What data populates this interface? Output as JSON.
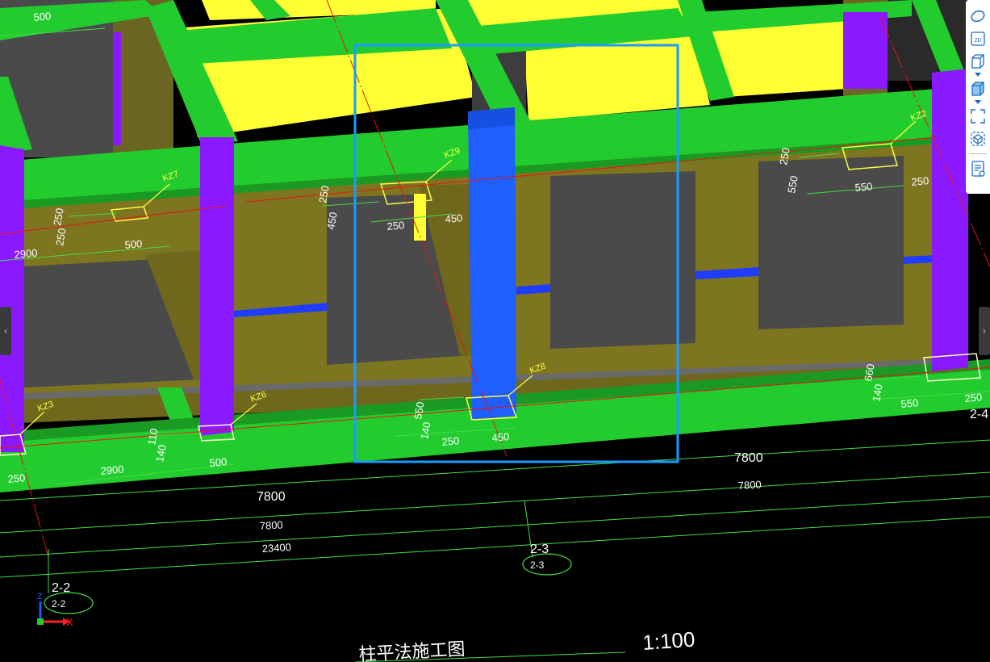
{
  "drawing": {
    "column_labels": {
      "kz2": "KZ2",
      "kz3": "KZ3",
      "kz6": "KZ6",
      "kz7": "KZ7",
      "kz8": "KZ8",
      "kz9": "KZ9"
    },
    "dims": {
      "d500_top": "500",
      "d2900_left": "2900",
      "d500_kz7": "500",
      "d250_kz7a": "250",
      "d250_kz7b": "250",
      "d250_kz9": "250",
      "d450_kz9": "450",
      "d250_kz9v": "250",
      "d450_kz9v": "450",
      "d250_kz2v": "250",
      "d550_kz2v": "550",
      "d550_kz2": "550",
      "d250_kz2": "250",
      "d140_kz6": "140",
      "d110_kz6": "110",
      "d500_kz6": "500",
      "d2900_bottom": "2900",
      "d250_left_bottom": "250",
      "d140_kz8": "140",
      "d550_kz8": "550",
      "d250_kz8": "250",
      "d450_kz8": "450",
      "d660_right": "660",
      "d140_right": "140",
      "d550_right": "550",
      "d250_right": "250",
      "d7800_a": "7800",
      "d7800_b": "7800",
      "d7800_c": "7800",
      "d7800_d": "7800",
      "d23400": "23400"
    },
    "axes": {
      "axis_2_2_label": "2-2",
      "axis_2_2_bubble": "2-2",
      "axis_2_3_label": "2-3",
      "axis_2_3_bubble": "2-3",
      "axis_2_4_label": "2-4"
    },
    "ucs": {
      "z": "Z",
      "x": "X"
    },
    "title": "柱平法施工图",
    "scale": "1:100"
  },
  "toolbar": {
    "icons": [
      "orbit-icon",
      "2d-icon",
      "3d-box-icon",
      "shaded-box-icon",
      "fit-view-icon",
      "view-cube-icon",
      "properties-icon"
    ],
    "label_2d": "2D"
  },
  "colors": {
    "beam": "#22cc2e",
    "column_purple": "#8a19ff",
    "column_blue": "#1f5eff",
    "slab_yellow": "#ffff33",
    "wall_olive": "#7d7520",
    "selection": "#1a9bff"
  }
}
